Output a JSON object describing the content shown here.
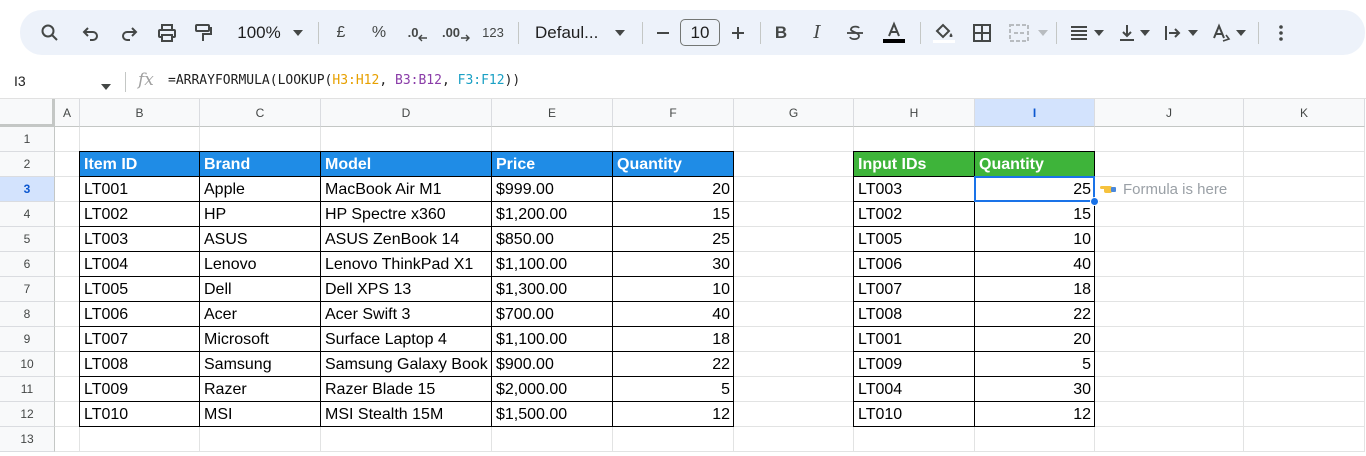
{
  "toolbar": {
    "zoom": "100%",
    "currency_symbol": "£",
    "percent_symbol": "%",
    "decrease_decimal": ".0",
    "increase_decimal": ".00",
    "more_formats": "123",
    "font_name": "Defaul...",
    "font_size": "10"
  },
  "formula_bar": {
    "cell_ref": "I3",
    "formula_prefix": "=ARRAYFORMULA(LOOKUP(",
    "arg1": "H3:H12",
    "comma1": ", ",
    "arg2": "B3:B12",
    "comma2": ", ",
    "arg3": "F3:F12",
    "formula_suffix": "))"
  },
  "columns": [
    "A",
    "B",
    "C",
    "D",
    "E",
    "F",
    "G",
    "H",
    "I",
    "J",
    "K"
  ],
  "rows": [
    "1",
    "2",
    "3",
    "4",
    "5",
    "6",
    "7",
    "8",
    "9",
    "10",
    "11",
    "12",
    "13"
  ],
  "selected_column": "I",
  "selected_row": "3",
  "main_table": {
    "headers": [
      "Item ID",
      "Brand",
      "Model",
      "Price",
      "Quantity"
    ],
    "rows": [
      [
        "LT001",
        "Apple",
        "MacBook Air M1",
        "$999.00",
        "20"
      ],
      [
        "LT002",
        "HP",
        "HP Spectre x360",
        "$1,200.00",
        "15"
      ],
      [
        "LT003",
        "ASUS",
        "ASUS ZenBook 14",
        "$850.00",
        "25"
      ],
      [
        "LT004",
        "Lenovo",
        "Lenovo ThinkPad X1",
        "$1,100.00",
        "30"
      ],
      [
        "LT005",
        "Dell",
        "Dell XPS 13",
        "$1,300.00",
        "10"
      ],
      [
        "LT006",
        "Acer",
        "Acer Swift 3",
        "$700.00",
        "40"
      ],
      [
        "LT007",
        "Microsoft",
        "Surface Laptop 4",
        "$1,100.00",
        "18"
      ],
      [
        "LT008",
        "Samsung",
        "Samsung Galaxy Book",
        "$900.00",
        "22"
      ],
      [
        "LT009",
        "Razer",
        "Razer Blade 15",
        "$2,000.00",
        "5"
      ],
      [
        "LT010",
        "MSI",
        "MSI Stealth 15M",
        "$1,500.00",
        "12"
      ]
    ]
  },
  "lookup_table": {
    "headers": [
      "Input IDs",
      "Quantity"
    ],
    "rows": [
      [
        "LT003",
        "25"
      ],
      [
        "LT002",
        "15"
      ],
      [
        "LT005",
        "10"
      ],
      [
        "LT006",
        "40"
      ],
      [
        "LT007",
        "18"
      ],
      [
        "LT008",
        "22"
      ],
      [
        "LT001",
        "20"
      ],
      [
        "LT009",
        "5"
      ],
      [
        "LT004",
        "30"
      ],
      [
        "LT010",
        "12"
      ]
    ]
  },
  "note": "Formula is here",
  "colors": {
    "main_header_bg": "#1f8ce6",
    "lookup_header_bg": "#3eb43a",
    "selection": "#1a73e8"
  }
}
